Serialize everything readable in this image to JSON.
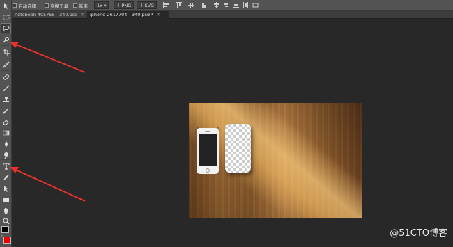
{
  "options_bar": {
    "auto_select_label": "自动选择",
    "transform_label": "变换工具",
    "new_label": "新离",
    "zoom_value": "1x",
    "png_label": "PNG",
    "svg_label": "SVG"
  },
  "tabs": [
    {
      "label": "notebook-405755__340.psd",
      "close": "✕"
    },
    {
      "label": "iphone-2617704__340.psd *",
      "close": "✕"
    }
  ],
  "tools": [
    "move-tool-icon",
    "marquee-tool-icon",
    "lasso-tool-icon",
    "quick-select-icon",
    "crop-tool-icon",
    "eyedropper-icon",
    "healing-brush-icon",
    "brush-icon",
    "stamp-icon",
    "history-brush-icon",
    "eraser-icon",
    "gradient-icon",
    "blur-icon",
    "dodge-icon",
    "type-tool-icon",
    "pen-tool-icon",
    "path-select-icon",
    "rectangle-icon",
    "hand-icon",
    "zoom-icon"
  ],
  "colors": {
    "foreground": "#000000",
    "background": "#e60000",
    "arrow": "#e8322c"
  },
  "watermark": "@51CTO博客"
}
